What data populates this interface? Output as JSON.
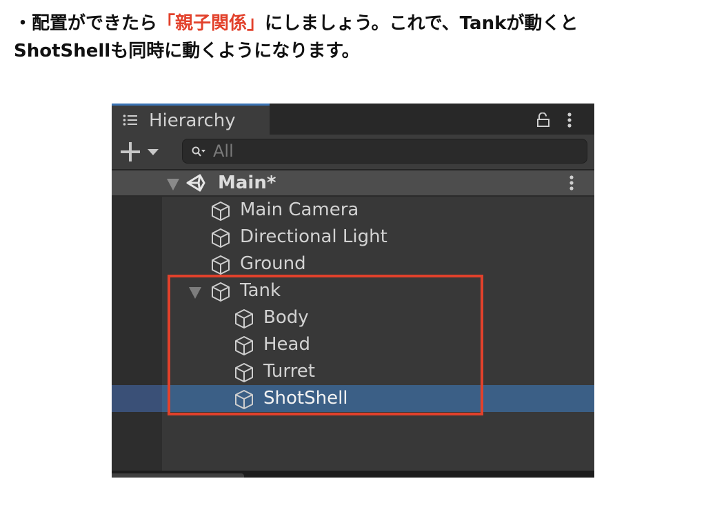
{
  "caption": {
    "line1_prefix": "・配置ができたら",
    "line1_highlight": "「親子関係」",
    "line1_suffix": "にしましょう。これで、Tankが動くと",
    "line2": "ShotShellも同時に動くようになります。",
    "highlight_color": "#e2412b"
  },
  "hierarchy": {
    "tab_label": "Hierarchy",
    "tab_icon": "list-icon",
    "lock_icon": "lock-open-icon",
    "menu_icon": "kebab-menu-icon",
    "add_icon": "plus-icon",
    "search": {
      "placeholder": "All",
      "value": "",
      "icon": "search-icon"
    },
    "scene": {
      "name": "Main*",
      "icon": "unity-logo-icon",
      "expanded": true
    },
    "items": [
      {
        "label": "Main Camera",
        "depth": 1,
        "icon": "cube-icon",
        "expanded": null,
        "selected": false
      },
      {
        "label": "Directional Light",
        "depth": 1,
        "icon": "cube-icon",
        "expanded": null,
        "selected": false
      },
      {
        "label": "Ground",
        "depth": 1,
        "icon": "cube-icon",
        "expanded": null,
        "selected": false
      },
      {
        "label": "Tank",
        "depth": 1,
        "icon": "cube-icon",
        "expanded": true,
        "selected": false
      },
      {
        "label": "Body",
        "depth": 2,
        "icon": "cube-icon",
        "expanded": null,
        "selected": false
      },
      {
        "label": "Head",
        "depth": 2,
        "icon": "cube-icon",
        "expanded": null,
        "selected": false
      },
      {
        "label": "Turret",
        "depth": 2,
        "icon": "cube-icon",
        "expanded": null,
        "selected": false
      },
      {
        "label": "ShotShell",
        "depth": 2,
        "icon": "cube-icon",
        "expanded": null,
        "selected": true
      }
    ],
    "selection_color": "#3b5f86",
    "annotation_box_color": "#e2412b"
  }
}
